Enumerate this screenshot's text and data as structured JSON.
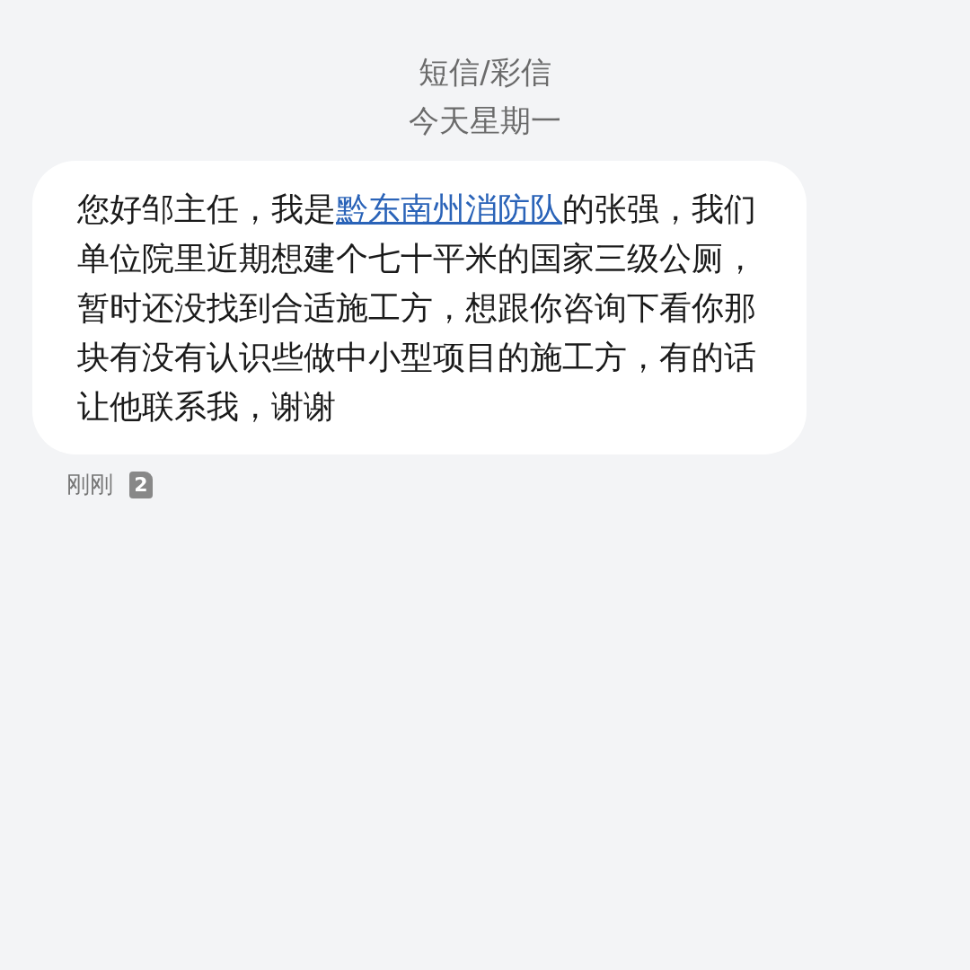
{
  "header": {
    "title": "短信/彩信",
    "date": "今天星期一"
  },
  "message": {
    "text_before": "您好邹主任，我是",
    "link": "黔东南州消防队",
    "text_after": "的张强，我们单位院里近期想建个七十平米的国家三级公厕，暂时还没找到合适施工方，想跟你咨询下看你那块有没有认识些做中小型项目的施工方，有的话让他联系我，谢谢",
    "time": "刚刚",
    "sim": "2"
  }
}
